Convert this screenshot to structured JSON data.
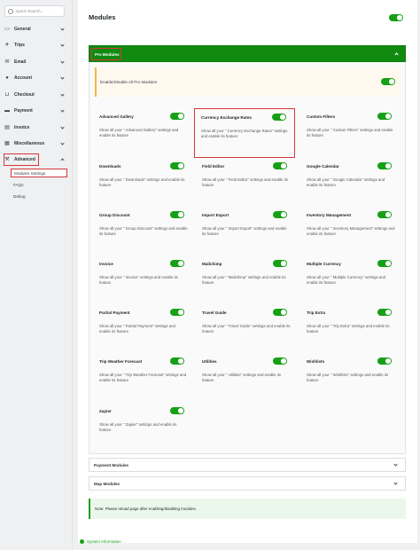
{
  "sidebar": {
    "search_placeholder": "Quick Search...",
    "items": [
      {
        "label": "General",
        "icon": "monitor-icon"
      },
      {
        "label": "Trips",
        "icon": "plane-icon"
      },
      {
        "label": "Email",
        "icon": "email-icon"
      },
      {
        "label": "Account",
        "icon": "user-icon"
      },
      {
        "label": "Checkout",
        "icon": "cart-icon"
      },
      {
        "label": "Payment",
        "icon": "card-icon"
      },
      {
        "label": "Invoice",
        "icon": "invoice-icon"
      },
      {
        "label": "Miscellaneous",
        "icon": "misc-icon"
      },
      {
        "label": "Advanced",
        "icon": "wrench-icon"
      }
    ],
    "sub_items": [
      "Modules Settings",
      "FAQs",
      "Debug"
    ]
  },
  "main": {
    "title": "Modules",
    "pro_modules_label": "Pro Modules",
    "enable_all_label": "Enable/Disable All Pro Modules",
    "modules": [
      {
        "title": "Advanced Gallery",
        "desc": "Show all your \" Advanced Gallery\" settings and enable its feature"
      },
      {
        "title": "Currency Exchange Rates",
        "desc": "Show all your \" Currency Exchange Rates\" settings and enable its feature"
      },
      {
        "title": "Custom Filters",
        "desc": "Show all your \" Custom Filters\" settings and enable its feature"
      },
      {
        "title": "Downloads",
        "desc": "Show all your \" Downloads\" settings and enable its feature"
      },
      {
        "title": "Field Editor",
        "desc": "Show all your \" Field Editor\" settings and enable its feature"
      },
      {
        "title": "Google Calendar",
        "desc": "Show all your \" Google Calendar\" settings and enable its feature"
      },
      {
        "title": "Group Discount",
        "desc": "Show all your \" Group Discount\" settings and enable its feature"
      },
      {
        "title": "Import Export",
        "desc": "Show all your \" Import Export\" settings and enable its feature"
      },
      {
        "title": "Inventory Management",
        "desc": "Show all your \" Inventory Management\" settings and enable its feature"
      },
      {
        "title": "Invoice",
        "desc": "Show all your \" Invoice\" settings and enable its feature"
      },
      {
        "title": "Mailchimp",
        "desc": "Show all your \" Mailchimp\" settings and enable its feature"
      },
      {
        "title": "Multiple Currency",
        "desc": "Show all your \" Multiple Currency\" settings and enable its feature"
      },
      {
        "title": "Partial Payment",
        "desc": "Show all your \" Partial Payment\" settings and enable its feature"
      },
      {
        "title": "Travel Guide",
        "desc": "Show all your \" Travel Guide\" settings and enable its feature"
      },
      {
        "title": "Trip Extra",
        "desc": "Show all your \" Trip Extra\" settings and enable its feature"
      },
      {
        "title": "Trip Weather Forecast",
        "desc": "Show all your \" Trip Weather Forecast\" settings and enable its feature"
      },
      {
        "title": "Utilities",
        "desc": "Show all your \" Utilities\" settings and enable its feature"
      },
      {
        "title": "Wishlists",
        "desc": "Show all your \" Wishlists\" settings and enable its feature"
      },
      {
        "title": "Zapier",
        "desc": "Show all your \" Zapier\" settings and enable its feature"
      }
    ],
    "accordions": [
      "Payment Modules",
      "Map Modules"
    ],
    "note": "Note: Please reload page after enabling/disabling modules."
  },
  "footer": {
    "system_info": "System Information"
  },
  "colors": {
    "accent": "#108b10",
    "toggle_on": "#15a015",
    "highlight": "#d63638"
  }
}
